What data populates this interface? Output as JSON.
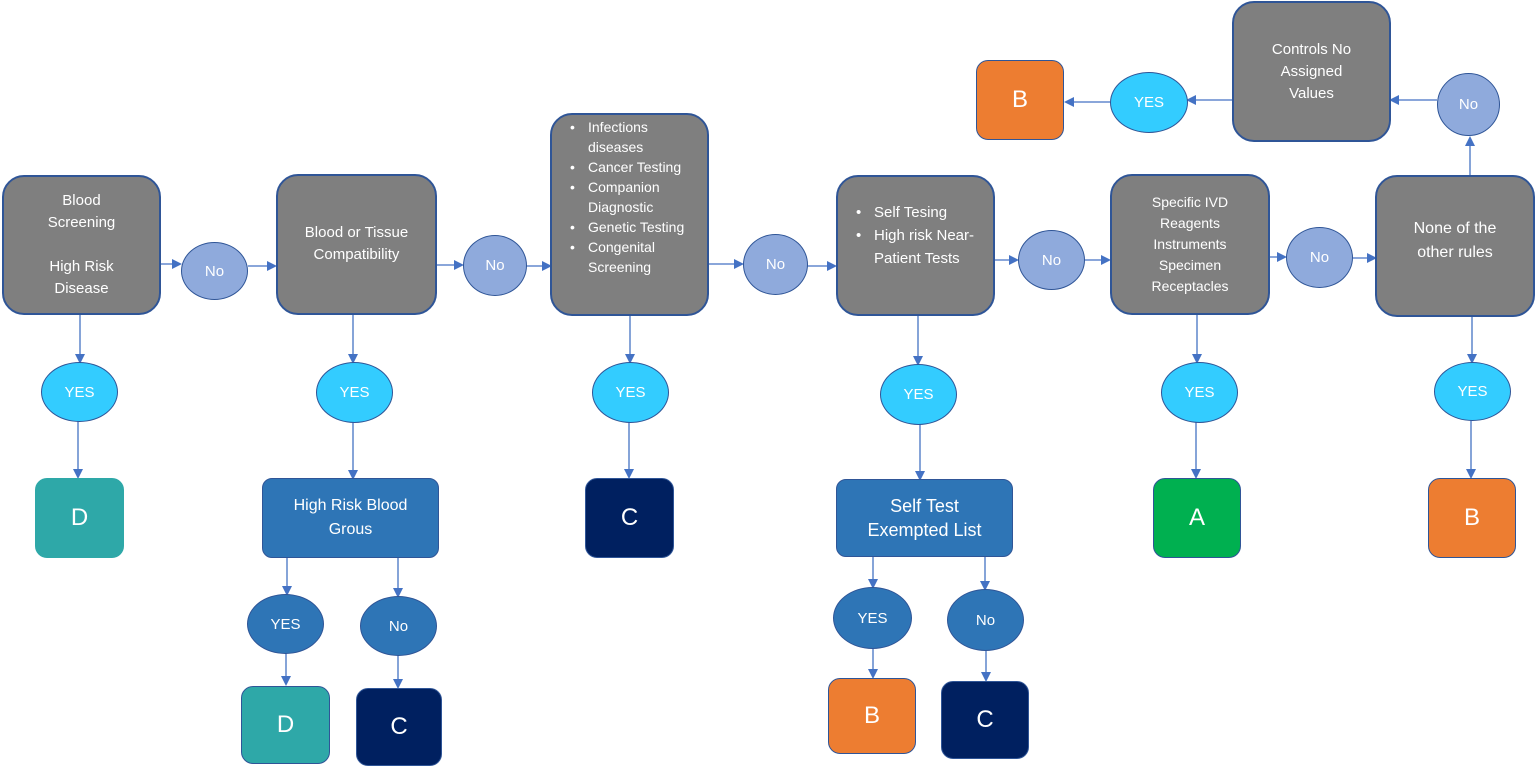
{
  "diagram": {
    "rules": {
      "blood_screening": {
        "lines": [
          "Blood",
          "Screening",
          "",
          "High Risk",
          "Disease"
        ]
      },
      "compatibility": {
        "lines": [
          "Blood or Tissue",
          "Compatibility"
        ]
      },
      "infections": {
        "bullets": [
          "Infections diseases",
          "Cancer Testing",
          "Companion Diagnostic",
          "Genetic Testing",
          "Congenital Screening"
        ]
      },
      "self_testing": {
        "bullets": [
          "Self Tesing",
          "High risk Near-Patient Tests"
        ]
      },
      "specific_ivd": {
        "lines": [
          "Specific IVD",
          "Reagents",
          "Instruments",
          "Specimen",
          "Receptacles"
        ]
      },
      "none_other": {
        "lines": [
          "None of the",
          "other rules"
        ]
      },
      "controls": {
        "lines": [
          "Controls No",
          "Assigned",
          "Values"
        ]
      }
    },
    "sub_questions": {
      "high_risk_blood": "High Risk Blood Grous",
      "self_test_exempted": "Self Test Exempted List"
    },
    "answers": {
      "yes": "YES",
      "no": "No"
    },
    "classes": {
      "A": {
        "label": "A",
        "color": "#00b050"
      },
      "B": {
        "label": "B",
        "color": "#ed7d31"
      },
      "C": {
        "label": "C",
        "color": "#002060"
      },
      "D": {
        "label": "D",
        "color": "#2ea8a8"
      }
    },
    "colors": {
      "rule_fill": "#7f7f7f",
      "no_fill": "#8faadc",
      "yes_fill": "#33ccff",
      "sub_fill": "#2e75b6",
      "edge": "#4472c4"
    }
  }
}
